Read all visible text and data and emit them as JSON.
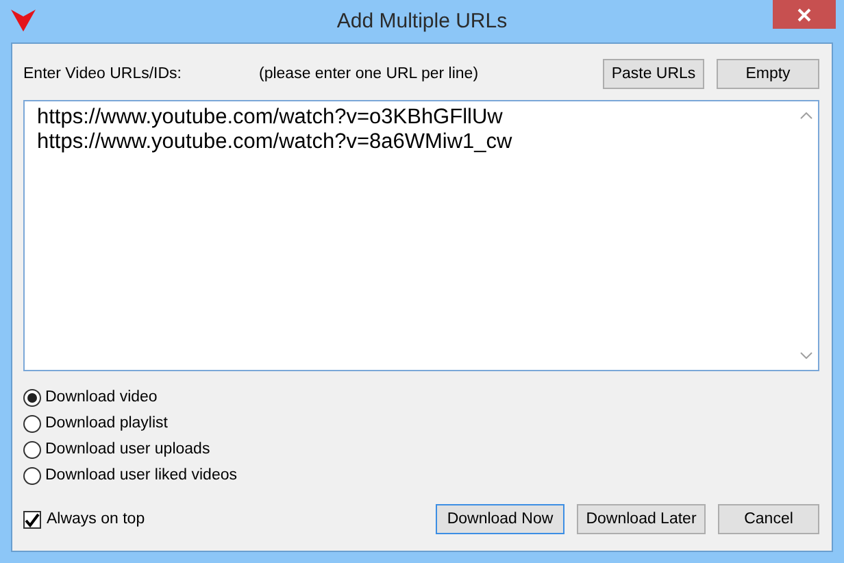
{
  "window": {
    "title": "Add Multiple URLs"
  },
  "url_label": "Enter Video URLs/IDs:",
  "hint": "(please enter one URL per line)",
  "top_buttons": [
    "Paste URLs",
    "Empty"
  ],
  "urls": [
    "https://www.youtube.com/watch?v=o3KBhGFllUw",
    "https://www.youtube.com/watch?v=8a6WMiw1_cw"
  ],
  "options": [
    {
      "label": "Download video",
      "selected": true
    },
    {
      "label": "Download playlist",
      "selected": false
    },
    {
      "label": "Download user uploads",
      "selected": false
    },
    {
      "label": "Download user liked videos",
      "selected": false
    }
  ],
  "always_on_top": {
    "label": "Always on top",
    "checked": true
  },
  "bottom_buttons": [
    {
      "label": "Download Now",
      "focused": true
    },
    {
      "label": "Download Later",
      "focused": false
    },
    {
      "label": "Cancel",
      "focused": false
    }
  ]
}
